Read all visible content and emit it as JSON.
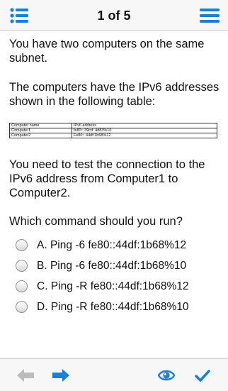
{
  "header": {
    "title": "1 of 5",
    "left_icon": "list-icon",
    "right_icon": "menu-icon"
  },
  "question": {
    "paragraph1": "You have two computers on the same subnet.",
    "paragraph2": "The computers have the IPv6 addresses shown in the following table:",
    "table": {
      "headers": [
        "Computer name",
        "IPv6 address"
      ],
      "rows": [
        [
          "Computer1",
          "fe80:: 39cd: 4d83%10"
        ],
        [
          "Computer2",
          "Fe80:: 44df:1b68%12"
        ]
      ]
    },
    "paragraph3": "You need to test the connection to the IPv6 address from Computer1 to Computer2.",
    "prompt": "Which command should you run?"
  },
  "options": [
    {
      "label": "A. Ping -6 fe80::44df:1b68%12"
    },
    {
      "label": "B. Ping -6 fe80::44df:1b68%10"
    },
    {
      "label": "C. Ping -R fe80::44df:1b68%12"
    },
    {
      "label": "D. Ping -R fe80::44df:1b68%10"
    }
  ],
  "footer": {
    "back_icon": "arrow-left-icon",
    "forward_icon": "arrow-right-icon",
    "reveal_icon": "eye-icon",
    "submit_icon": "checkmark-icon"
  },
  "colors": {
    "accent": "#1a7fd9",
    "disabled": "#bcbcbc",
    "bar_background": "#f7f7f7"
  }
}
